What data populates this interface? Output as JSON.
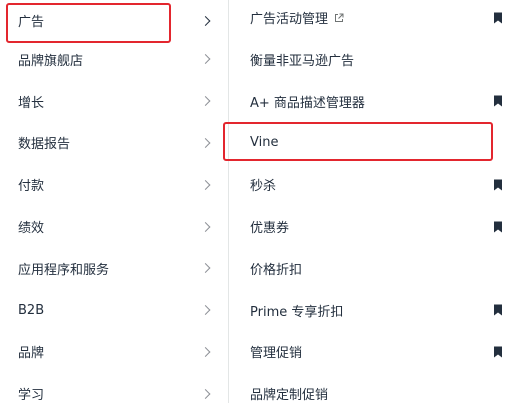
{
  "left_menu": {
    "items": [
      {
        "label": "广告"
      },
      {
        "label": "品牌旗舰店"
      },
      {
        "label": "增长"
      },
      {
        "label": "数据报告"
      },
      {
        "label": "付款"
      },
      {
        "label": "绩效"
      },
      {
        "label": "应用程序和服务"
      },
      {
        "label": "B2B"
      },
      {
        "label": "品牌"
      },
      {
        "label": "学习"
      }
    ]
  },
  "right_menu": {
    "items": [
      {
        "label": "广告活动管理",
        "external": true,
        "bookmarked": true
      },
      {
        "label": "衡量非亚马逊广告",
        "bookmarked": false
      },
      {
        "label": "A+ 商品描述管理器",
        "bookmarked": true
      },
      {
        "label": "Vine",
        "bookmarked": false
      },
      {
        "label": "秒杀",
        "bookmarked": true
      },
      {
        "label": "优惠券",
        "bookmarked": true
      },
      {
        "label": "价格折扣",
        "bookmarked": false
      },
      {
        "label": "Prime 专享折扣",
        "bookmarked": true
      },
      {
        "label": "管理促销",
        "bookmarked": true
      },
      {
        "label": "品牌定制促销",
        "bookmarked": false
      }
    ]
  },
  "colors": {
    "text": "#232f3e",
    "chevron": "#8d9096",
    "divider": "#e3e6e6",
    "highlight": "#e3262e"
  }
}
